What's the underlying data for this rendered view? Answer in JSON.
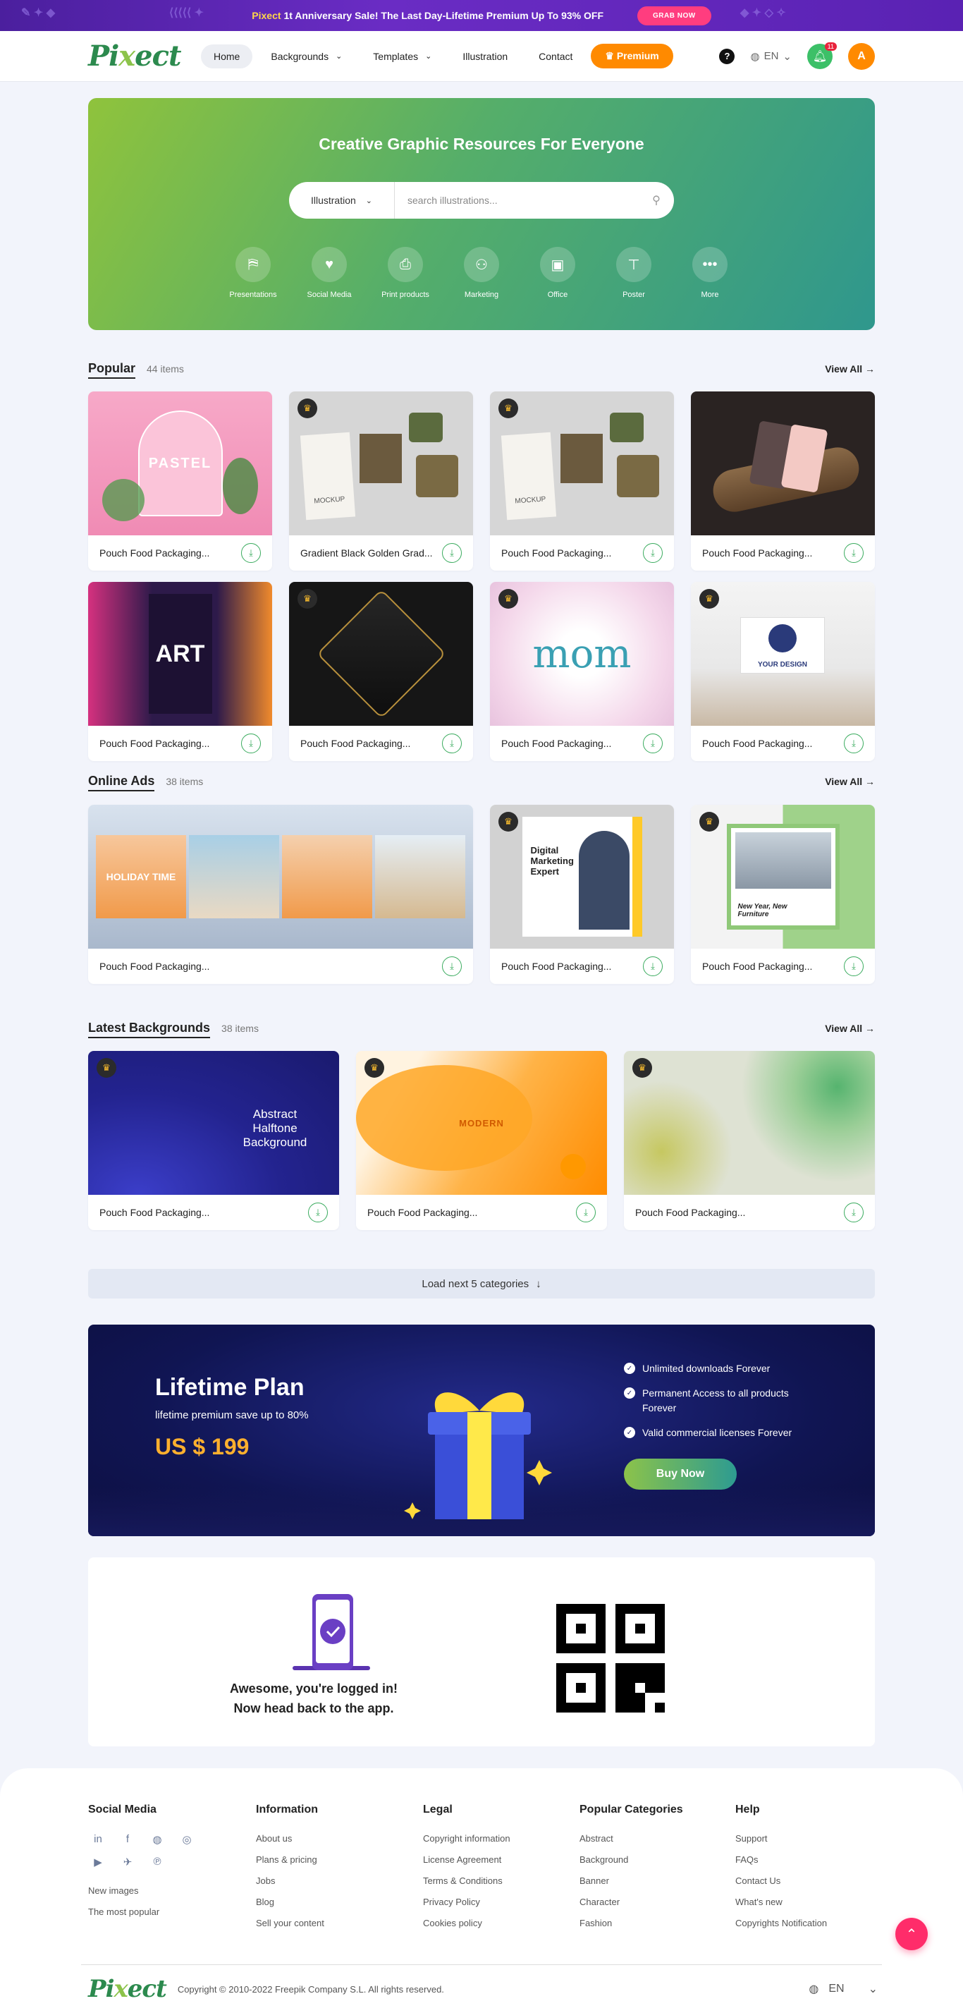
{
  "promo": {
    "brand": "Pixect",
    "text": "1t Anniversary Sale! The Last Day-Lifetime Premium Up To 93% OFF",
    "button": "GRAB NOW"
  },
  "nav": {
    "logo": "Pixect",
    "items": [
      {
        "label": "Home",
        "active": true
      },
      {
        "label": "Backgrounds",
        "dropdown": true
      },
      {
        "label": "Templates",
        "dropdown": true
      },
      {
        "label": "Illustration"
      },
      {
        "label": "Contact"
      }
    ],
    "premium": "Premium",
    "lang": "EN",
    "notifications": "11",
    "avatar": "A"
  },
  "hero": {
    "title": "Creative Graphic Resources For Everyone",
    "search": {
      "category": "Illustration",
      "placeholder": "search illustrations..."
    },
    "categories": [
      {
        "label": "Presentations",
        "icon": "presentation-icon"
      },
      {
        "label": "Social Media",
        "icon": "heart-icon"
      },
      {
        "label": "Print products",
        "icon": "printer-icon"
      },
      {
        "label": "Marketing",
        "icon": "people-icon"
      },
      {
        "label": "Office",
        "icon": "briefcase-icon"
      },
      {
        "label": "Poster",
        "icon": "signpost-icon"
      },
      {
        "label": "More",
        "icon": "more-icon"
      }
    ]
  },
  "popular": {
    "title": "Popular",
    "count": "44 items",
    "view_all": "View All",
    "cards": [
      {
        "title": "Pouch Food Packaging...",
        "premium": false,
        "img_text": "PASTEL"
      },
      {
        "title": "Gradient Black Golden Grad...",
        "premium": true,
        "img_text": "MOCKUP"
      },
      {
        "title": "Pouch Food Packaging...",
        "premium": true,
        "img_text": "MOCKUP"
      },
      {
        "title": "Pouch Food Packaging...",
        "premium": false,
        "img_text": ""
      },
      {
        "title": "Pouch Food Packaging...",
        "premium": false,
        "img_text": "ART"
      },
      {
        "title": "Pouch Food Packaging...",
        "premium": true,
        "img_text": ""
      },
      {
        "title": "Pouch Food Packaging...",
        "premium": true,
        "img_text": "mom"
      },
      {
        "title": "Pouch Food Packaging...",
        "premium": true,
        "img_text": "YOUR DESIGN"
      }
    ]
  },
  "online_ads": {
    "title": "Online Ads",
    "count": "38 items",
    "view_all": "View All",
    "cards": [
      {
        "title": "Pouch Food Packaging...",
        "premium": false,
        "img_text": "HOLIDAY TIME"
      },
      {
        "title": "Pouch Food Packaging...",
        "premium": true,
        "img_text": "Digital Marketing Expert"
      },
      {
        "title": "Pouch Food Packaging...",
        "premium": true,
        "img_text": "New Year, New Furniture"
      }
    ]
  },
  "latest": {
    "title": "Latest Backgrounds",
    "count": "38 items",
    "view_all": "View All",
    "cards": [
      {
        "title": "Pouch Food Packaging...",
        "premium": true,
        "img_text": "Abstract Halftone Background"
      },
      {
        "title": "Pouch Food Packaging...",
        "premium": true,
        "img_text": "MODERN"
      },
      {
        "title": "Pouch Food Packaging...",
        "premium": true,
        "img_text": ""
      }
    ]
  },
  "load_more": "Load next 5 categories",
  "lifetime": {
    "title": "Lifetime Plan",
    "subtitle": "lifetime premium save up to 80%",
    "price": "US $ 199",
    "features": [
      "Unlimited downloads Forever",
      "Permanent Access to all products Forever",
      "Valid commercial licenses Forever"
    ],
    "button": "Buy Now"
  },
  "logged_in": {
    "line1": "Awesome, you're logged in!",
    "line2": "Now head back to the app."
  },
  "footer": {
    "social": {
      "title": "Social Media",
      "icons": [
        "linkedin-icon",
        "facebook-icon",
        "globe-icon",
        "instagram-icon",
        "youtube-icon",
        "twitter-icon",
        "pinterest-icon"
      ],
      "links": [
        "New images",
        "The most popular"
      ]
    },
    "information": {
      "title": "Information",
      "links": [
        "About us",
        "Plans & pricing",
        "Jobs",
        "Blog",
        "Sell your content"
      ]
    },
    "legal": {
      "title": "Legal",
      "links": [
        "Copyright information",
        "License Agreement",
        "Terms & Conditions",
        "Privacy Policy",
        "Cookies policy"
      ]
    },
    "popular": {
      "title": "Popular Categories",
      "links": [
        "Abstract",
        "Background",
        "Banner",
        "Character",
        "Fashion"
      ]
    },
    "help": {
      "title": "Help",
      "links": [
        "Support",
        "FAQs",
        "Contact Us",
        "What's new",
        "Copyrights Notification"
      ]
    },
    "copyright": "Copyright © 2010-2022 Freepik Company S.L. All rights reserved.",
    "lang": "EN"
  },
  "colors": {
    "accent": "#ff8a00",
    "green": "#3aab5e",
    "promo": "#5a22b3",
    "pink": "#ff2c6a"
  }
}
